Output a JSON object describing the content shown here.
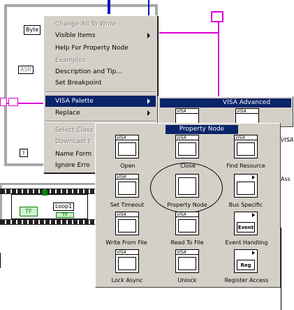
{
  "context_menu": {
    "items": [
      {
        "label": "Change All To Write",
        "disabled": true,
        "submenu": false
      },
      {
        "label": "Visible Items",
        "disabled": false,
        "submenu": true
      },
      {
        "label": "Help For Property Node",
        "disabled": false,
        "submenu": false
      },
      {
        "label": "Examples",
        "disabled": true,
        "submenu": false
      },
      {
        "label": "Description and Tip...",
        "disabled": false,
        "submenu": false
      },
      {
        "label": "Set Breakpoint",
        "disabled": false,
        "submenu": false
      },
      {
        "label": "VISA Palette",
        "disabled": false,
        "submenu": true,
        "selected": true
      },
      {
        "label": "Replace",
        "disabled": false,
        "submenu": true
      },
      {
        "label": "Select Class",
        "disabled": true,
        "submenu": false
      },
      {
        "label": "Downcast t",
        "disabled": true,
        "submenu": false
      },
      {
        "label": "Name Form",
        "disabled": false,
        "submenu": false
      },
      {
        "label": "Ignore Erro",
        "disabled": false,
        "submenu": false
      }
    ]
  },
  "visa_advanced": {
    "title": "VISA Advanced"
  },
  "property_node_palette": {
    "title": "Property Node",
    "items": [
      {
        "label": "Open",
        "icon": "visa-open-icon"
      },
      {
        "label": "Close",
        "icon": "visa-close-icon"
      },
      {
        "label": "Find Resource",
        "icon": "visa-find-resource-icon"
      },
      {
        "label": "Set Timeout",
        "icon": "visa-set-timeout-icon"
      },
      {
        "label": "Property Node",
        "icon": "property-node-icon"
      },
      {
        "label": "Bus Specific",
        "icon": "bus-specific-icon"
      },
      {
        "label": "",
        "icon": "visa-write-file-icon"
      },
      {
        "label": "",
        "icon": "visa-read-file-icon"
      },
      {
        "label": "Event",
        "icon": "event-handling-icon"
      },
      {
        "label": "Write From File",
        "icon": "write-from-file-label"
      },
      {
        "label": "Read To File",
        "icon": "read-to-file-label"
      },
      {
        "label": "Event Handling",
        "icon": "event-handling-label"
      },
      {
        "label": "Reg",
        "icon": "register-access-icon"
      },
      {
        "label": "Lock Async",
        "icon": "lock-async-icon"
      },
      {
        "label": "Unlock",
        "icon": "unlock-icon"
      },
      {
        "label": "Register Access",
        "icon": "register-access-label"
      }
    ]
  },
  "diagram": {
    "byte_label": "Byte",
    "asr_label": "ASR",
    "loop_label": "Loop1",
    "tf_label": "TF",
    "tf2_label": "TF",
    "info_label": "i",
    "right_fragment": "VISA",
    "right_fragment2": "Ass"
  }
}
